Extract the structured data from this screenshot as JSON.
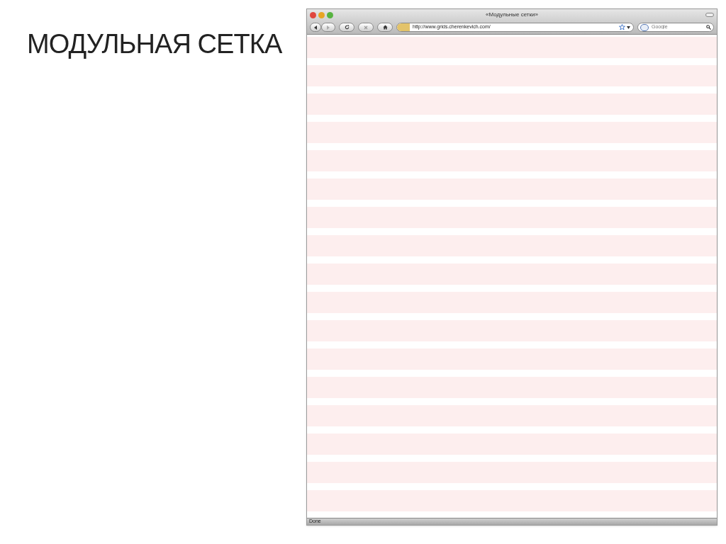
{
  "slide_title": "МОДУЛЬНАЯ СЕТКА",
  "window": {
    "title": "«Модульные сетки»"
  },
  "toolbar": {
    "address": "http://www.grids.cherenkevich.com/",
    "search": {
      "placeholder": "Google"
    }
  },
  "status_bar": "Done"
}
